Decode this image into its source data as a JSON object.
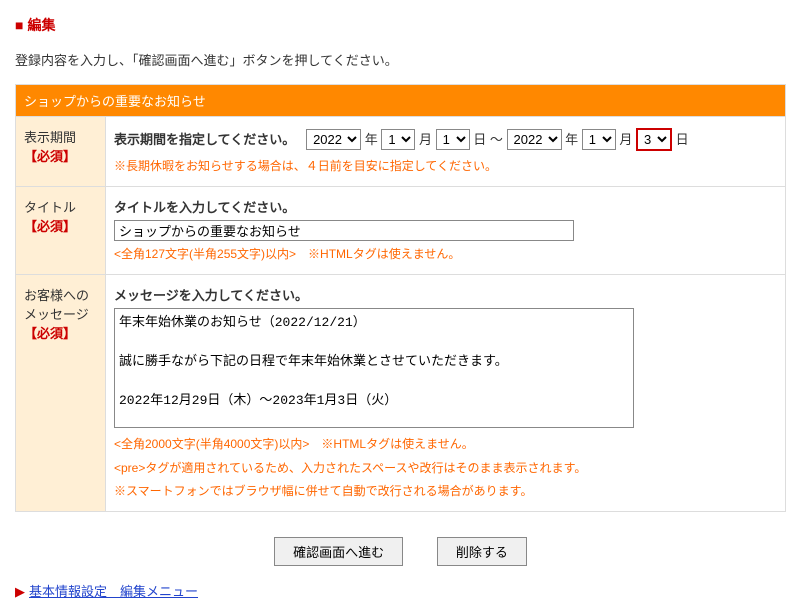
{
  "page": {
    "title": "編集",
    "instruction": "登録内容を入力し、「確認画面へ進む」ボタンを押してください。"
  },
  "section": {
    "header": "ショップからの重要なお知らせ"
  },
  "period": {
    "th_label": "表示期間",
    "required": "【必須】",
    "label": "表示期間を指定してください。",
    "year_unit": "年",
    "month_unit": "月",
    "day_unit": "日",
    "sep": "～",
    "start_year": "2022",
    "start_month": "1",
    "start_day": "1",
    "end_year": "2022",
    "end_month": "1",
    "end_day": "3",
    "note": "※長期休暇をお知らせする場合は、４日前を目安に指定してください。"
  },
  "title_field": {
    "th_label": "タイトル",
    "required": "【必須】",
    "label": "タイトルを入力してください。",
    "value": "ショップからの重要なお知らせ",
    "note": "<全角127文字(半角255文字)以内>　※HTMLタグは使えません。"
  },
  "message": {
    "th_label": "お客様へのメッセージ",
    "required": "【必須】",
    "label": "メッセージを入力してください。",
    "value": "年末年始休業のお知らせ（2022/12/21）\n\n誠に勝手ながら下記の日程で年末年始休業とさせていただきます。\n\n2022年12月29日（木）～2023年1月3日（火）\n\nご注文内容の確認、お問い合わせのご返信などは翌営業日から順次ご対応させていただきます。\nご迷惑をおかけいたしますが、何卒よろしくお願い申し上げます。",
    "note1": "<全角2000文字(半角4000文字)以内>　※HTMLタグは使えません。",
    "note2": "<pre>タグが適用されているため、入力されたスペースや改行はそのまま表示されます。",
    "note3": "※スマートフォンではブラウザ幅に併せて自動で改行される場合があります。"
  },
  "buttons": {
    "confirm": "確認画面へ進む",
    "delete": "削除する"
  },
  "footer": {
    "link": "基本情報設定　編集メニュー"
  }
}
